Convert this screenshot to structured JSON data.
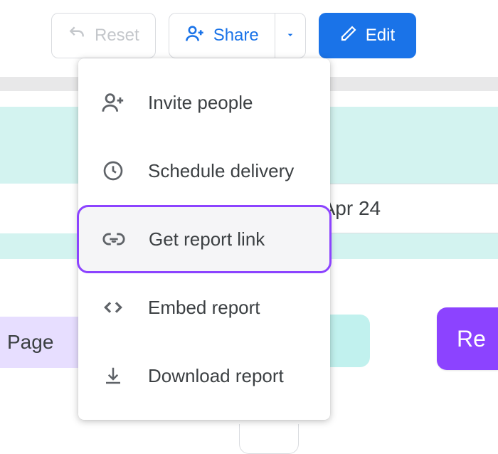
{
  "toolbar": {
    "reset_label": "Reset",
    "share_label": "Share",
    "edit_label": "Edit"
  },
  "background": {
    "date_range": "2024 - Apr 24",
    "page_label": "Page",
    "purple_fragment": "Re"
  },
  "share_menu": {
    "items": [
      {
        "label": "Invite people"
      },
      {
        "label": "Schedule delivery"
      },
      {
        "label": "Get report link"
      },
      {
        "label": "Embed report"
      },
      {
        "label": "Download report"
      }
    ]
  }
}
